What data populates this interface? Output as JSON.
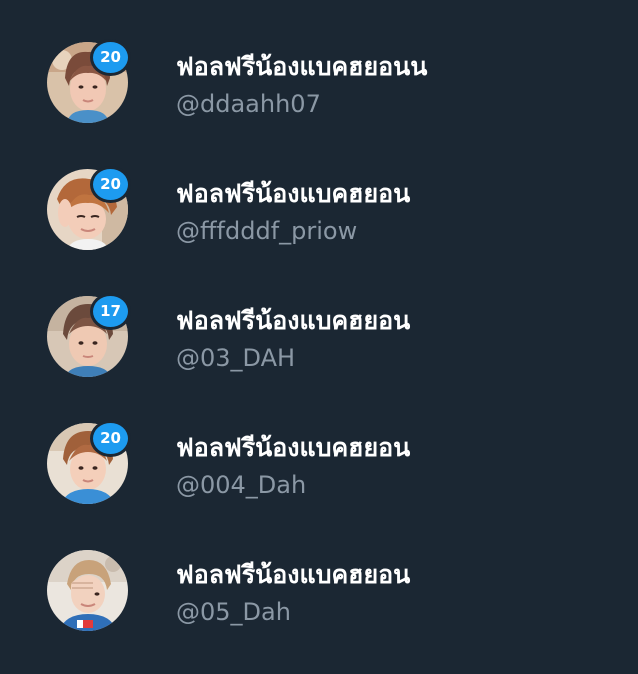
{
  "theme": {
    "background": "#1b2733",
    "badge_color": "#1d9bf0",
    "name_color": "#ffffff",
    "handle_color": "#8b98a5"
  },
  "accounts": [
    {
      "display_name": "ฟอลฟรีน้องแบคฮยอนน",
      "handle": "@ddaahh07",
      "badge": "20",
      "avatar": "avatar-photo-1"
    },
    {
      "display_name": "ฟอลฟรีน้องแบคฮยอน",
      "handle": "@fffdddf_priow",
      "badge": "20",
      "avatar": "avatar-photo-2"
    },
    {
      "display_name": "ฟอลฟรีน้องแบคฮยอน",
      "handle": "@03_DAH",
      "badge": "17",
      "avatar": "avatar-photo-3"
    },
    {
      "display_name": "ฟอลฟรีน้องแบคฮยอน",
      "handle": "@004_Dah",
      "badge": "20",
      "avatar": "avatar-photo-4"
    },
    {
      "display_name": "ฟอลฟรีน้องแบคฮยอน",
      "handle": "@05_Dah",
      "badge": null,
      "avatar": "avatar-photo-5"
    }
  ]
}
